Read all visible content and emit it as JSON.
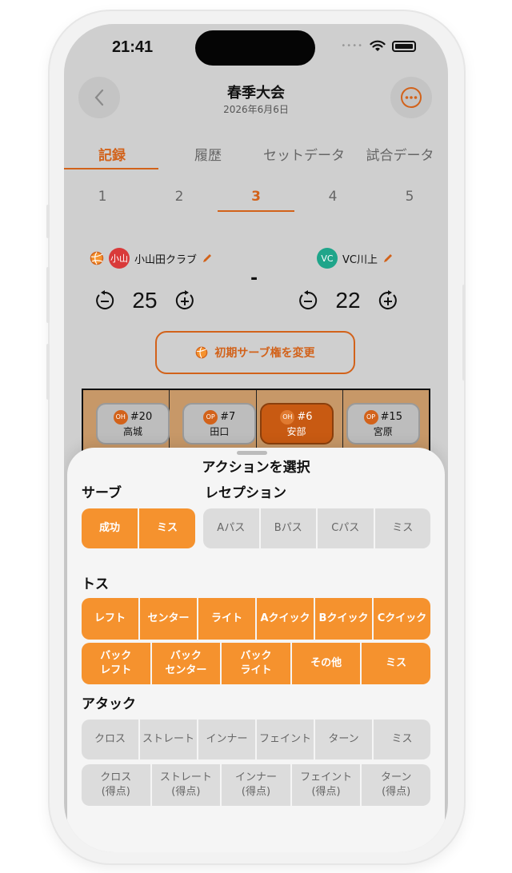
{
  "status": {
    "time": "21:41",
    "dots": "••••"
  },
  "header": {
    "title": "春季大会",
    "date": "2026年6月6日"
  },
  "tabs": [
    {
      "label": "記録",
      "active": true
    },
    {
      "label": "履歴",
      "active": false
    },
    {
      "label": "セットデータ",
      "active": false
    },
    {
      "label": "試合データ",
      "active": false
    }
  ],
  "sets": [
    "1",
    "2",
    "3",
    "4",
    "5"
  ],
  "active_set": "3",
  "home": {
    "avatar": "小山",
    "name": "小山田クラブ",
    "score": "25",
    "color": "#d93a3a"
  },
  "away": {
    "avatar": "VC",
    "name": "VC川上",
    "score": "22",
    "color": "#1fa58a"
  },
  "score_separator": "-",
  "serve_button": "初期サーブ権を変更",
  "court": [
    {
      "pos": "OH",
      "number": "#20",
      "name": "高城",
      "selected": false
    },
    {
      "pos": "OP",
      "number": "#7",
      "name": "田口",
      "selected": false
    },
    {
      "pos": "OH",
      "number": "#6",
      "name": "安部",
      "selected": true
    },
    {
      "pos": "OP",
      "number": "#15",
      "name": "宮原",
      "selected": false
    }
  ],
  "sheet": {
    "title": "アクションを選択",
    "serve": {
      "label": "サーブ",
      "buttons": [
        "成功",
        "ミス"
      ]
    },
    "reception": {
      "label": "レセプション",
      "buttons": [
        "Aパス",
        "Bパス",
        "Cパス",
        "ミス"
      ]
    },
    "toss": {
      "label": "トス",
      "row1": [
        "レフト",
        "センター",
        "ライト",
        "Aクイック",
        "Bクイック",
        "Cクイック"
      ],
      "row2": [
        {
          "l1": "バック",
          "l2": "レフト"
        },
        {
          "l1": "バック",
          "l2": "センター"
        },
        {
          "l1": "バック",
          "l2": "ライト"
        },
        {
          "l1": "その他",
          "l2": ""
        },
        {
          "l1": "ミス",
          "l2": ""
        }
      ]
    },
    "attack": {
      "label": "アタック",
      "row1": [
        "クロス",
        "ストレート",
        "インナー",
        "フェイント",
        "ターン",
        "ミス"
      ],
      "row2": [
        {
          "l1": "クロス",
          "l2": "(得点)"
        },
        {
          "l1": "ストレート",
          "l2": "(得点)"
        },
        {
          "l1": "インナー",
          "l2": "(得点)"
        },
        {
          "l1": "フェイント",
          "l2": "(得点)"
        },
        {
          "l1": "ターン",
          "l2": "(得点)"
        }
      ]
    }
  },
  "colors": {
    "accent": "#d2621a",
    "button_orange": "#f5922e",
    "button_gray": "#dcdcdc"
  }
}
